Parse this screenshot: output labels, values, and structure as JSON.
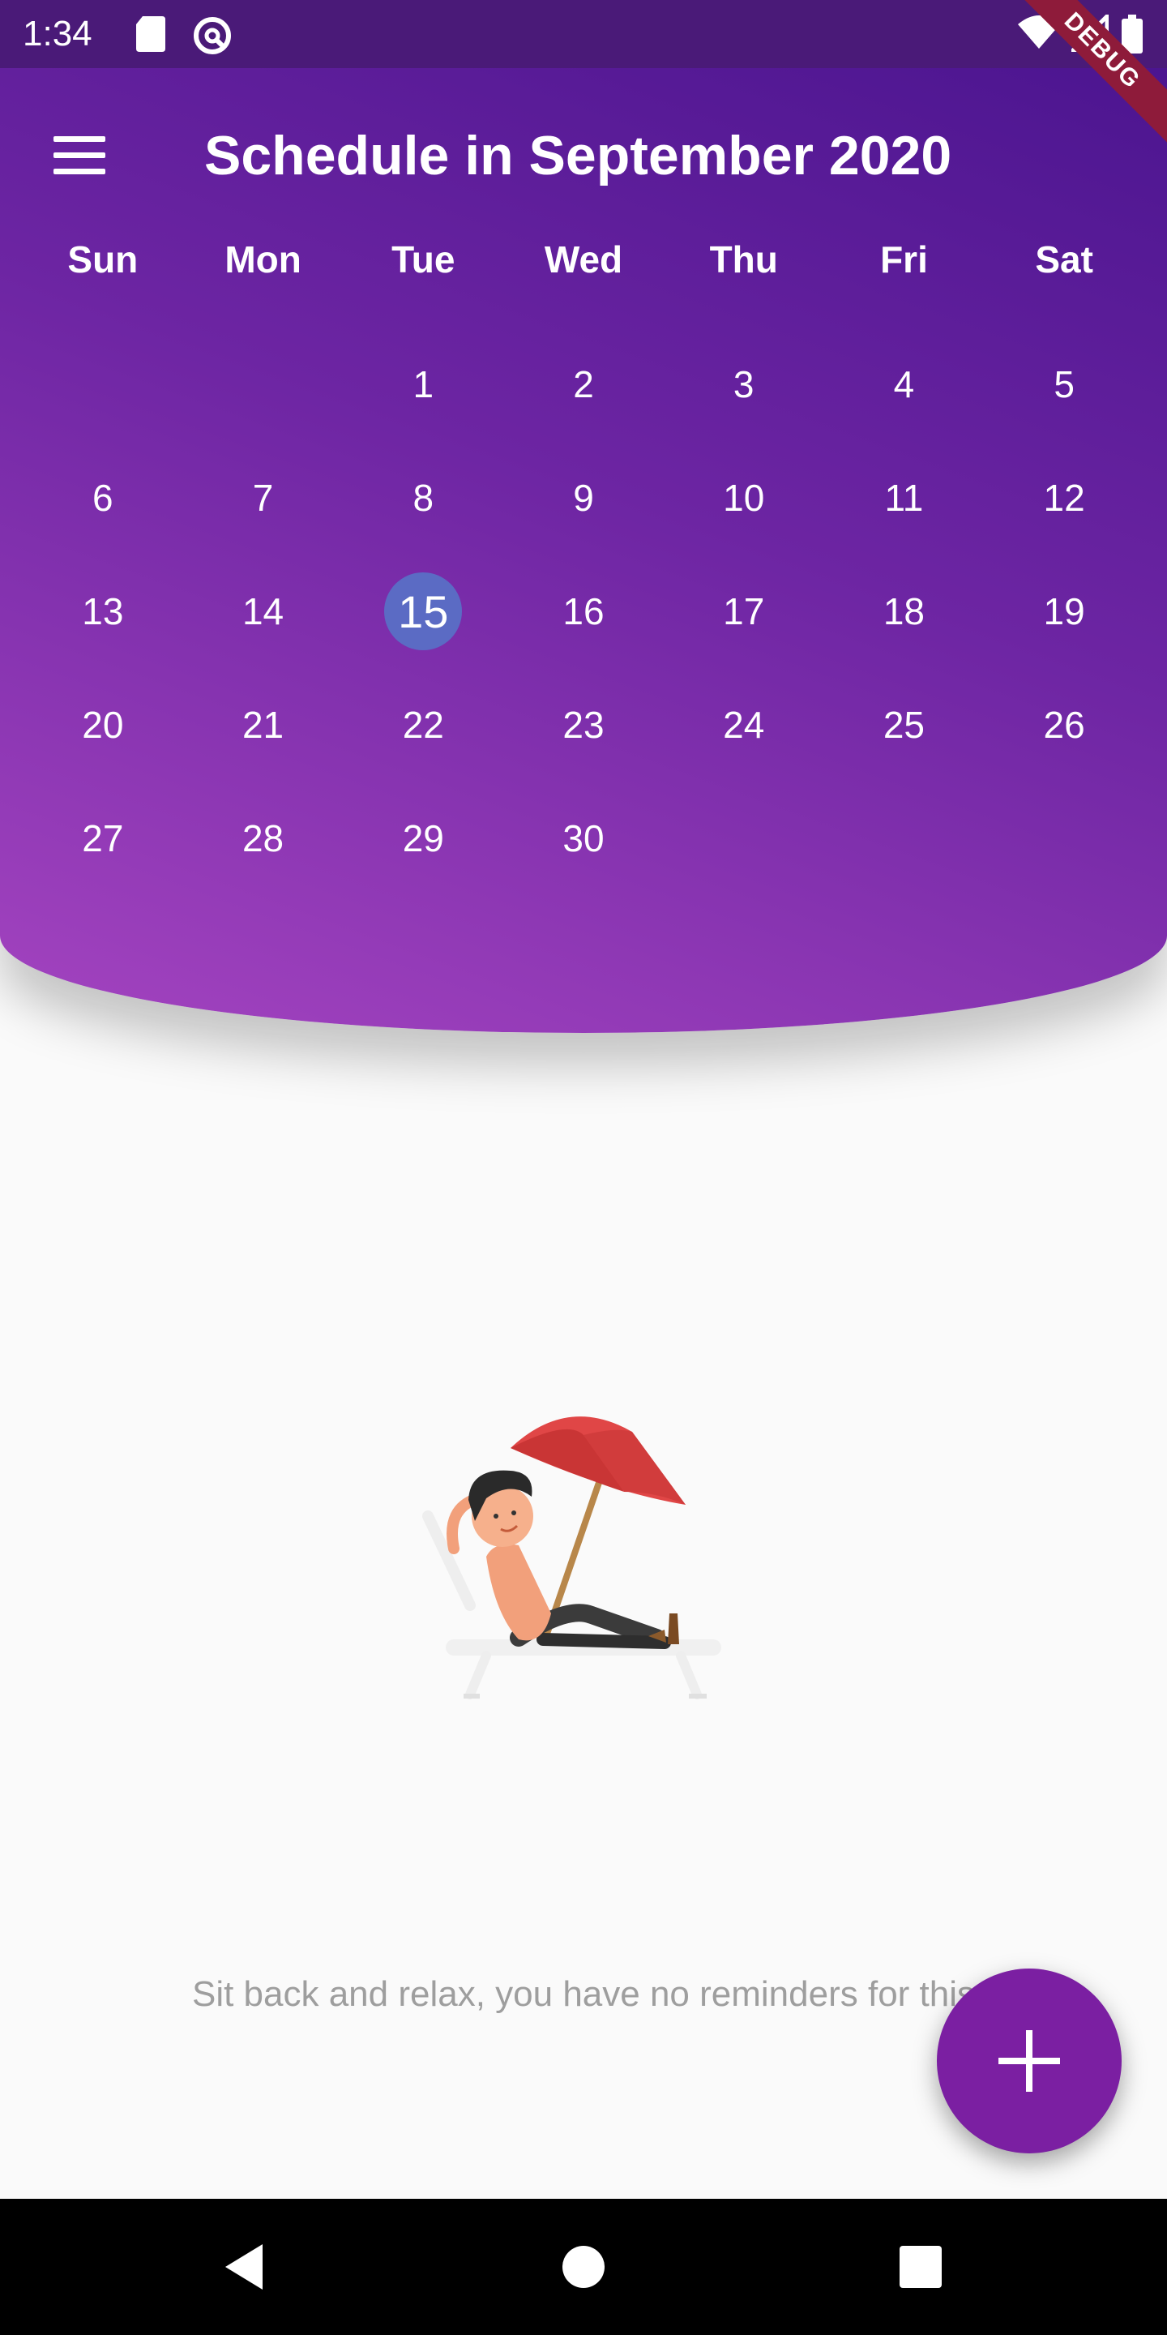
{
  "status_bar": {
    "time": "1:34",
    "debug_label": "DEBUG"
  },
  "header": {
    "title": "Schedule in September 2020",
    "weekdays": [
      "Sun",
      "Mon",
      "Tue",
      "Wed",
      "Thu",
      "Fri",
      "Sat"
    ],
    "days": [
      "",
      "",
      "1",
      "2",
      "3",
      "4",
      "5",
      "6",
      "7",
      "8",
      "9",
      "10",
      "11",
      "12",
      "13",
      "14",
      "15",
      "16",
      "17",
      "18",
      "19",
      "20",
      "21",
      "22",
      "23",
      "24",
      "25",
      "26",
      "27",
      "28",
      "29",
      "30",
      "",
      "",
      ""
    ],
    "selected_day": "15"
  },
  "empty_state": {
    "message": "Sit back and relax, you have no reminders for this"
  },
  "colors": {
    "accent": "#7b1fa2",
    "selected": "#5b6bc4"
  }
}
